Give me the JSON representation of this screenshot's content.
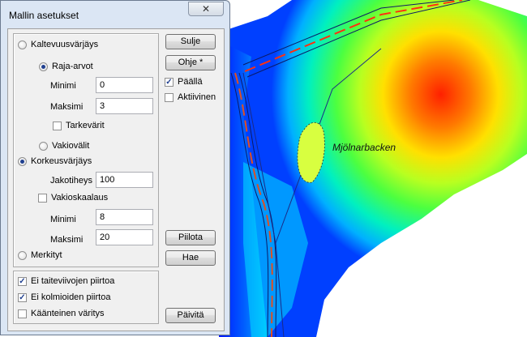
{
  "window": {
    "title": "Mallin asetukset",
    "close_glyph": "✕"
  },
  "coloring": {
    "slope_label": "Kaltevuusvärjäys",
    "range_values_label": "Raja-arvot",
    "minimum_label": "Minimi",
    "minimum_value": "0",
    "maximum_label": "Maksimi",
    "maximum_value": "3",
    "precise_colors_label": "Tarkevärit",
    "constant_interval_label": "Vakiovälit",
    "height_label": "Korkeusvärjäys",
    "interval_label": "Jakotiheys",
    "interval_value": "100",
    "constant_scaling_label": "Vakioskaalaus",
    "height_minimum_label": "Minimi",
    "height_minimum_value": "8",
    "height_maximum_label": "Maksimi",
    "height_maximum_value": "20",
    "marked_label": "Merkityt"
  },
  "options": {
    "no_breaklines_label": "Ei taiteviivojen piirtoa",
    "no_triangles_label": "Ei kolmioiden piirtoa",
    "reverse_colors_label": "Käänteinen väritys"
  },
  "buttons": {
    "close_label": "Sulje",
    "help_label": "Ohje *",
    "on_label": "Päällä",
    "active_label": "Aktiivinen",
    "hide_label": "Piilota",
    "fetch_label": "Hae",
    "update_label": "Päivitä"
  },
  "state": {
    "slope_selected": false,
    "range_values_selected": true,
    "constant_interval_selected": false,
    "height_selected": true,
    "marked_selected": false,
    "precise_colors_checked": false,
    "constant_scaling_checked": false,
    "on_checked": true,
    "active_checked": false,
    "no_breaklines_checked": true,
    "no_triangles_checked": true,
    "reverse_colors_checked": false
  },
  "map": {
    "place_label": "Mjölnarbacken"
  }
}
